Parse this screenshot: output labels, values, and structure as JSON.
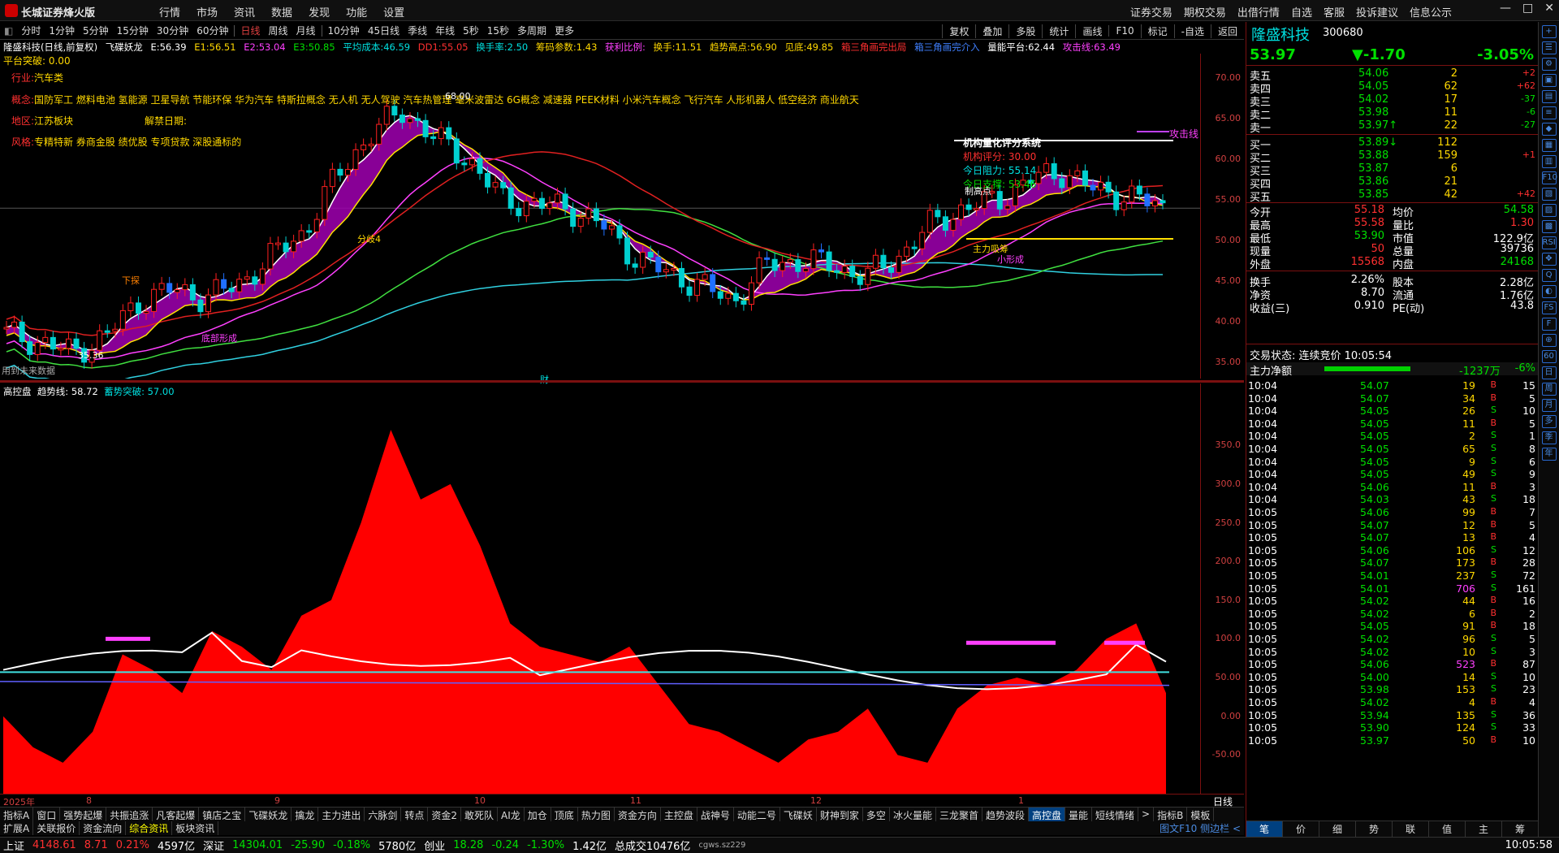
{
  "app": {
    "title": "长城证券烽火版"
  },
  "menu_left": [
    "行情",
    "市场",
    "资讯",
    "数据",
    "发现",
    "功能",
    "设置"
  ],
  "menu_right": [
    "证券交易",
    "期权交易",
    "出借行情",
    "自选",
    "客服",
    "投诉建议",
    "信息公示"
  ],
  "window_controls": {
    "min": "—",
    "max": "□",
    "close": "✕"
  },
  "periods": [
    "分时",
    "1分钟",
    "5分钟",
    "15分钟",
    "30分钟",
    "60分钟",
    "日线",
    "周线",
    "月线",
    "10分钟",
    "45日线",
    "季线",
    "年线",
    "5秒",
    "15秒",
    "多周期",
    "更多"
  ],
  "period_active": "日线",
  "period_right": [
    "复权",
    "叠加",
    "多股",
    "统计",
    "画线",
    "F10",
    "标记",
    "-自选",
    "返回"
  ],
  "indicator_header": [
    {
      "t": "隆盛科技(日线,前复权)",
      "c": "w"
    },
    {
      "t": "飞碟妖龙",
      "c": "w"
    },
    {
      "t": "E:56.39",
      "c": "w"
    },
    {
      "t": "E1:56.51",
      "c": "y"
    },
    {
      "t": "E2:53.04",
      "c": "m"
    },
    {
      "t": "E3:50.85",
      "c": "g"
    },
    {
      "t": "平均成本:46.59",
      "c": "c"
    },
    {
      "t": "DD1:55.05",
      "c": "r"
    },
    {
      "t": "换手率:2.50",
      "c": "c"
    },
    {
      "t": "筹码参数:1.43",
      "c": "y"
    },
    {
      "t": "获利比例:",
      "c": "m"
    },
    {
      "t": "换手:11.51",
      "c": "y"
    },
    {
      "t": "趋势高点:56.90",
      "c": "y"
    },
    {
      "t": "见底:49.85",
      "c": "y"
    },
    {
      "t": "箱三角画完出局",
      "c": "r"
    },
    {
      "t": "箱三角画完介入",
      "c": "b"
    },
    {
      "t": "量能平台:62.44",
      "c": "w"
    },
    {
      "t": "攻击线:63.49",
      "c": "m"
    }
  ],
  "platform_break": "平台突破: 0.00",
  "info_lines": {
    "industry_label": "行业:",
    "industry": "汽车类",
    "concept_label": "概念:",
    "concept": "国防军工 燃料电池 氢能源 卫星导航 节能环保 华为汽车 特斯拉概念 无人机 无人驾驶 汽车热管理 毫米波雷达 6G概念 减速器 PEEK材料 小米汽车概念 飞行汽车 人形机器人 低空经济 商业航天",
    "region_label": "地区:",
    "region": "江苏板块",
    "unlock_label": "解禁日期:",
    "style_label": "风格:",
    "style": "专精特新 券商金股 绩优股 专项贷款 深股通标的"
  },
  "chart_notes": {
    "future_data": "用到未来数据",
    "cai": "财",
    "low_price": "35.36",
    "high_price": "68.00",
    "panel_title": "机构量化评分系统",
    "score_label": "机构评分:",
    "score": "30.00",
    "resist_label": "今日阻力:",
    "resist": "55.14",
    "support_label": "今日支撑:",
    "support": "53.46",
    "attack_line": "攻击线",
    "labels": [
      "下探",
      "分歧4",
      "底部形成",
      "主力吸筹",
      "制高点",
      "小形成"
    ]
  },
  "axis_main": [
    "70.00",
    "65.00",
    "60.00",
    "55.00",
    "50.00",
    "45.00",
    "40.00",
    "35.00"
  ],
  "axis_sub": [
    "350.0",
    "300.0",
    "250.0",
    "200.0",
    "150.0",
    "100.0",
    "50.00",
    "0.00",
    "-50.00"
  ],
  "sub_header": [
    {
      "t": "高控盘",
      "c": "w"
    },
    {
      "t": "趋势线: 58.72",
      "c": "w"
    },
    {
      "t": "蓄势突破: 57.00",
      "c": "c"
    }
  ],
  "date_axis": [
    "2025年",
    "8",
    "9",
    "10",
    "11",
    "12",
    "1"
  ],
  "date_axis_right": "日线",
  "tabs1": [
    "指标A",
    "窗口",
    "强势起爆",
    "共振追涨",
    "凡客起爆",
    "镇店之宝",
    "飞碟妖龙",
    "擒龙",
    "主力进出",
    "六脉剑",
    "转点",
    "资金2",
    "敢死队",
    "AI龙",
    "加仓",
    "顶底",
    "热力图",
    "资金方向",
    "主控盘",
    "战神号",
    "动能二号",
    "飞碟妖",
    "财神到家",
    "多空",
    "冰火量能",
    "三龙聚首",
    "趋势波段",
    "高控盘",
    "量能",
    "短线情绪",
    ">",
    "指标B",
    "模板"
  ],
  "tabs1_active": "高控盘",
  "tabs2": [
    "扩展A",
    "关联报价",
    "资金流向",
    "综合资讯",
    "板块资讯"
  ],
  "tabs2_active": "综合资讯",
  "tabs2_right": "图文F10 侧边栏 <",
  "status": {
    "sh_label": "上证",
    "sh": "4148.61",
    "sh_chg": "8.71",
    "sh_pct": "0.21%",
    "sh_amt": "4597亿",
    "sz_label": "深证",
    "sz": "14304.01",
    "sz_chg": "-25.90",
    "sz_pct": "-0.18%",
    "sz_amt": "5780亿",
    "cy_label": "创业",
    "cy": "18.28",
    "cy_chg": "-0.24",
    "cy_pct": "-1.30%",
    "cy_amt": "1.42亿",
    "total_label": "总成交",
    "total": "10476亿",
    "server": "cgws.sz229",
    "time": "10:05:58"
  },
  "stock": {
    "name": "隆盛科技",
    "code": "300680",
    "price": "53.97",
    "change": "▼-1.70",
    "pct": "-3.05%"
  },
  "asks": [
    {
      "l": "卖五",
      "p": "54.06",
      "v": "2",
      "d": "+2"
    },
    {
      "l": "卖四",
      "p": "54.05",
      "v": "62",
      "d": "+62"
    },
    {
      "l": "卖三",
      "p": "54.02",
      "v": "17",
      "d": "-37"
    },
    {
      "l": "卖二",
      "p": "53.98",
      "v": "11",
      "d": "-6"
    },
    {
      "l": "卖一",
      "p": "53.97↑",
      "v": "22",
      "d": "-27"
    }
  ],
  "bids": [
    {
      "l": "买一",
      "p": "53.89↓",
      "v": "112",
      "d": ""
    },
    {
      "l": "买二",
      "p": "53.88",
      "v": "159",
      "d": "+1"
    },
    {
      "l": "买三",
      "p": "53.87",
      "v": "6",
      "d": ""
    },
    {
      "l": "买四",
      "p": "53.86",
      "v": "21",
      "d": ""
    },
    {
      "l": "买五",
      "p": "53.85",
      "v": "42",
      "d": "+42"
    }
  ],
  "stats": [
    {
      "l1": "今开",
      "v1": "55.18",
      "c1": "r",
      "l2": "均价",
      "v2": "54.58",
      "c2": "g"
    },
    {
      "l1": "最高",
      "v1": "55.58",
      "c1": "r",
      "l2": "量比",
      "v2": "1.30",
      "c2": "r"
    },
    {
      "l1": "最低",
      "v1": "53.90",
      "c1": "g",
      "l2": "市值",
      "v2": "122.9亿",
      "c2": "w"
    },
    {
      "l1": "现量",
      "v1": "50",
      "c1": "r",
      "l2": "总量",
      "v2": "39736",
      "c2": "w"
    },
    {
      "l1": "外盘",
      "v1": "15568",
      "c1": "r",
      "l2": "内盘",
      "v2": "24168",
      "c2": "g"
    },
    {
      "l1": "换手",
      "v1": "2.26%",
      "c1": "w",
      "l2": "股本",
      "v2": "2.28亿",
      "c2": "w"
    },
    {
      "l1": "净资",
      "v1": "8.70",
      "c1": "w",
      "l2": "流通",
      "v2": "1.76亿",
      "c2": "w"
    },
    {
      "l1": "收益(三)",
      "v1": "0.910",
      "c1": "w",
      "l2": "PE(动)",
      "v2": "43.8",
      "c2": "w"
    }
  ],
  "trade_status": "交易状态: 连续竞价 10:05:54",
  "main_flow": {
    "label": "主力净额",
    "value": "-1237万",
    "pct": "-6%"
  },
  "ticks": [
    [
      "10:04",
      "54.07",
      "19",
      "B",
      "15"
    ],
    [
      "10:04",
      "54.07",
      "34",
      "B",
      "5"
    ],
    [
      "10:04",
      "54.05",
      "26",
      "S",
      "10"
    ],
    [
      "10:04",
      "54.05",
      "11",
      "B",
      "5"
    ],
    [
      "10:04",
      "54.05",
      "2",
      "S",
      "1"
    ],
    [
      "10:04",
      "54.05",
      "65",
      "S",
      "8"
    ],
    [
      "10:04",
      "54.05",
      "9",
      "S",
      "6"
    ],
    [
      "10:04",
      "54.05",
      "49",
      "S",
      "9"
    ],
    [
      "10:04",
      "54.06",
      "11",
      "B",
      "3"
    ],
    [
      "10:04",
      "54.03",
      "43",
      "S",
      "18"
    ],
    [
      "10:05",
      "54.06",
      "99",
      "B",
      "7"
    ],
    [
      "10:05",
      "54.07",
      "12",
      "B",
      "5"
    ],
    [
      "10:05",
      "54.07",
      "13",
      "B",
      "4"
    ],
    [
      "10:05",
      "54.06",
      "106",
      "S",
      "12"
    ],
    [
      "10:05",
      "54.07",
      "173",
      "B",
      "28"
    ],
    [
      "10:05",
      "54.01",
      "237",
      "S",
      "72"
    ],
    [
      "10:05",
      "54.01",
      "706",
      "S",
      "161"
    ],
    [
      "10:05",
      "54.02",
      "44",
      "B",
      "16"
    ],
    [
      "10:05",
      "54.02",
      "6",
      "B",
      "2"
    ],
    [
      "10:05",
      "54.05",
      "91",
      "B",
      "18"
    ],
    [
      "10:05",
      "54.02",
      "96",
      "S",
      "5"
    ],
    [
      "10:05",
      "54.02",
      "10",
      "S",
      "3"
    ],
    [
      "10:05",
      "54.06",
      "523",
      "B",
      "87"
    ],
    [
      "10:05",
      "54.00",
      "14",
      "S",
      "10"
    ],
    [
      "10:05",
      "53.98",
      "153",
      "S",
      "23"
    ],
    [
      "10:05",
      "54.02",
      "4",
      "B",
      "4"
    ],
    [
      "10:05",
      "53.94",
      "135",
      "S",
      "36"
    ],
    [
      "10:05",
      "53.90",
      "124",
      "S",
      "33"
    ],
    [
      "10:05",
      "53.97",
      "50",
      "B",
      "10"
    ]
  ],
  "rtabs": [
    "笔",
    "价",
    "细",
    "势",
    "联",
    "值",
    "主",
    "筹"
  ],
  "rtabs_active": "笔",
  "rside_icons": [
    "+",
    "☰",
    "⚙",
    "▣",
    "▤",
    "≡",
    "◆",
    "▦",
    "▥",
    "F10",
    "▧",
    "▨",
    "▩",
    "RSI",
    "✥",
    "Q",
    "◐",
    "FS",
    "F",
    "⊕",
    "60",
    "日",
    "周",
    "月",
    "多",
    "季",
    "年"
  ],
  "chart_data": {
    "type": "candlestick",
    "ylim": [
      33,
      73
    ],
    "x": [
      "2025年",
      "8",
      "9",
      "10",
      "11",
      "12",
      "1"
    ],
    "close_approx": [
      38.5,
      37.5,
      36.2,
      38.2,
      42.5,
      44.0,
      43.0,
      44.5,
      48.0,
      51.0,
      58.0,
      63.0,
      66.0,
      62.5,
      60.0,
      55.0,
      54.5,
      54.0,
      52.0,
      48.0,
      46.0,
      44.5,
      42.5,
      47.0,
      47.5,
      47.0,
      45.5,
      48.0,
      52.0,
      54.0,
      55.0,
      57.5,
      58.5,
      56.0,
      55.5,
      53.97
    ],
    "series": [
      {
        "name": "E1",
        "last": 56.51
      },
      {
        "name": "E2",
        "last": 53.04
      },
      {
        "name": "E3",
        "last": 50.85
      },
      {
        "name": "平均成本",
        "last": 46.59
      },
      {
        "name": "攻击线",
        "last": 63.49
      }
    ],
    "sub": {
      "name": "高控盘",
      "ylim": [
        -100,
        400
      ],
      "趋势线": 58.72,
      "蓄势突破": 57.0,
      "values_approx": [
        0,
        -40,
        -60,
        -20,
        80,
        60,
        30,
        110,
        90,
        60,
        130,
        150,
        250,
        370,
        280,
        300,
        220,
        120,
        90,
        80,
        70,
        90,
        40,
        -10,
        -20,
        -40,
        -60,
        -30,
        -20,
        10,
        -50,
        -60,
        10,
        40,
        50,
        40,
        60,
        100,
        120,
        30
      ]
    }
  }
}
